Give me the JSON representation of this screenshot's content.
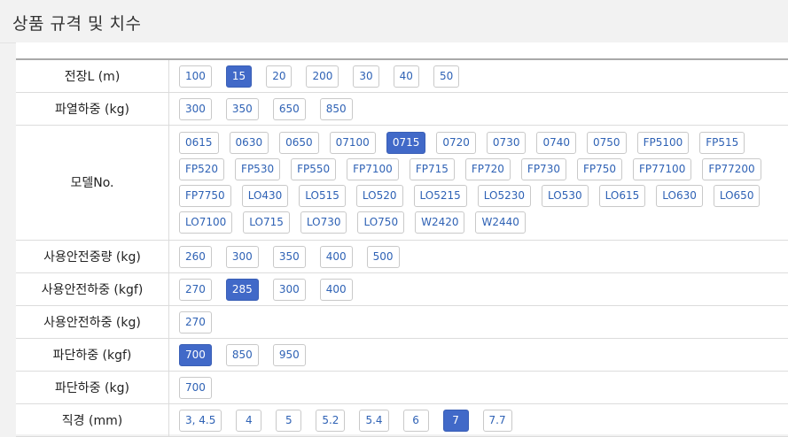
{
  "page": {
    "title": "상품 규격 및 치수"
  },
  "rows": [
    {
      "label": "전장L (m)",
      "options": [
        "100",
        "15",
        "20",
        "200",
        "30",
        "40",
        "50"
      ],
      "selected": [
        "15"
      ]
    },
    {
      "label": "파열하중 (kg)",
      "options": [
        "300",
        "350",
        "650",
        "850"
      ],
      "selected": []
    },
    {
      "label": "모델No.",
      "options": [
        "0615",
        "0630",
        "0650",
        "07100",
        "0715",
        "0720",
        "0730",
        "0740",
        "0750",
        "FP5100",
        "FP515",
        "FP520",
        "FP530",
        "FP550",
        "FP7100",
        "FP715",
        "FP720",
        "FP730",
        "FP750",
        "FP77100",
        "FP77200",
        "FP7750",
        "LO430",
        "LO515",
        "LO520",
        "LO5215",
        "LO5230",
        "LO530",
        "LO615",
        "LO630",
        "LO650",
        "LO7100",
        "LO715",
        "LO730",
        "LO750",
        "W2420",
        "W2440"
      ],
      "selected": [
        "0715"
      ]
    },
    {
      "label": "사용안전중량 (kg)",
      "options": [
        "260",
        "300",
        "350",
        "400",
        "500"
      ],
      "selected": []
    },
    {
      "label": "사용안전하중 (kgf)",
      "options": [
        "270",
        "285",
        "300",
        "400"
      ],
      "selected": [
        "285"
      ]
    },
    {
      "label": "사용안전하중 (kg)",
      "options": [
        "270"
      ],
      "selected": []
    },
    {
      "label": "파단하중 (kgf)",
      "options": [
        "700",
        "850",
        "950"
      ],
      "selected": [
        "700"
      ]
    },
    {
      "label": "파단하중 (kg)",
      "options": [
        "700"
      ],
      "selected": []
    },
    {
      "label": "직경 (mm)",
      "options": [
        "3, 4.5",
        "4",
        "5",
        "5.2",
        "5.4",
        "6",
        "7",
        "7.7"
      ],
      "selected": [
        "7"
      ]
    }
  ],
  "colors": {
    "accent": "#4169c8",
    "option_text": "#2f62b5",
    "border": "#c9c9c9"
  }
}
